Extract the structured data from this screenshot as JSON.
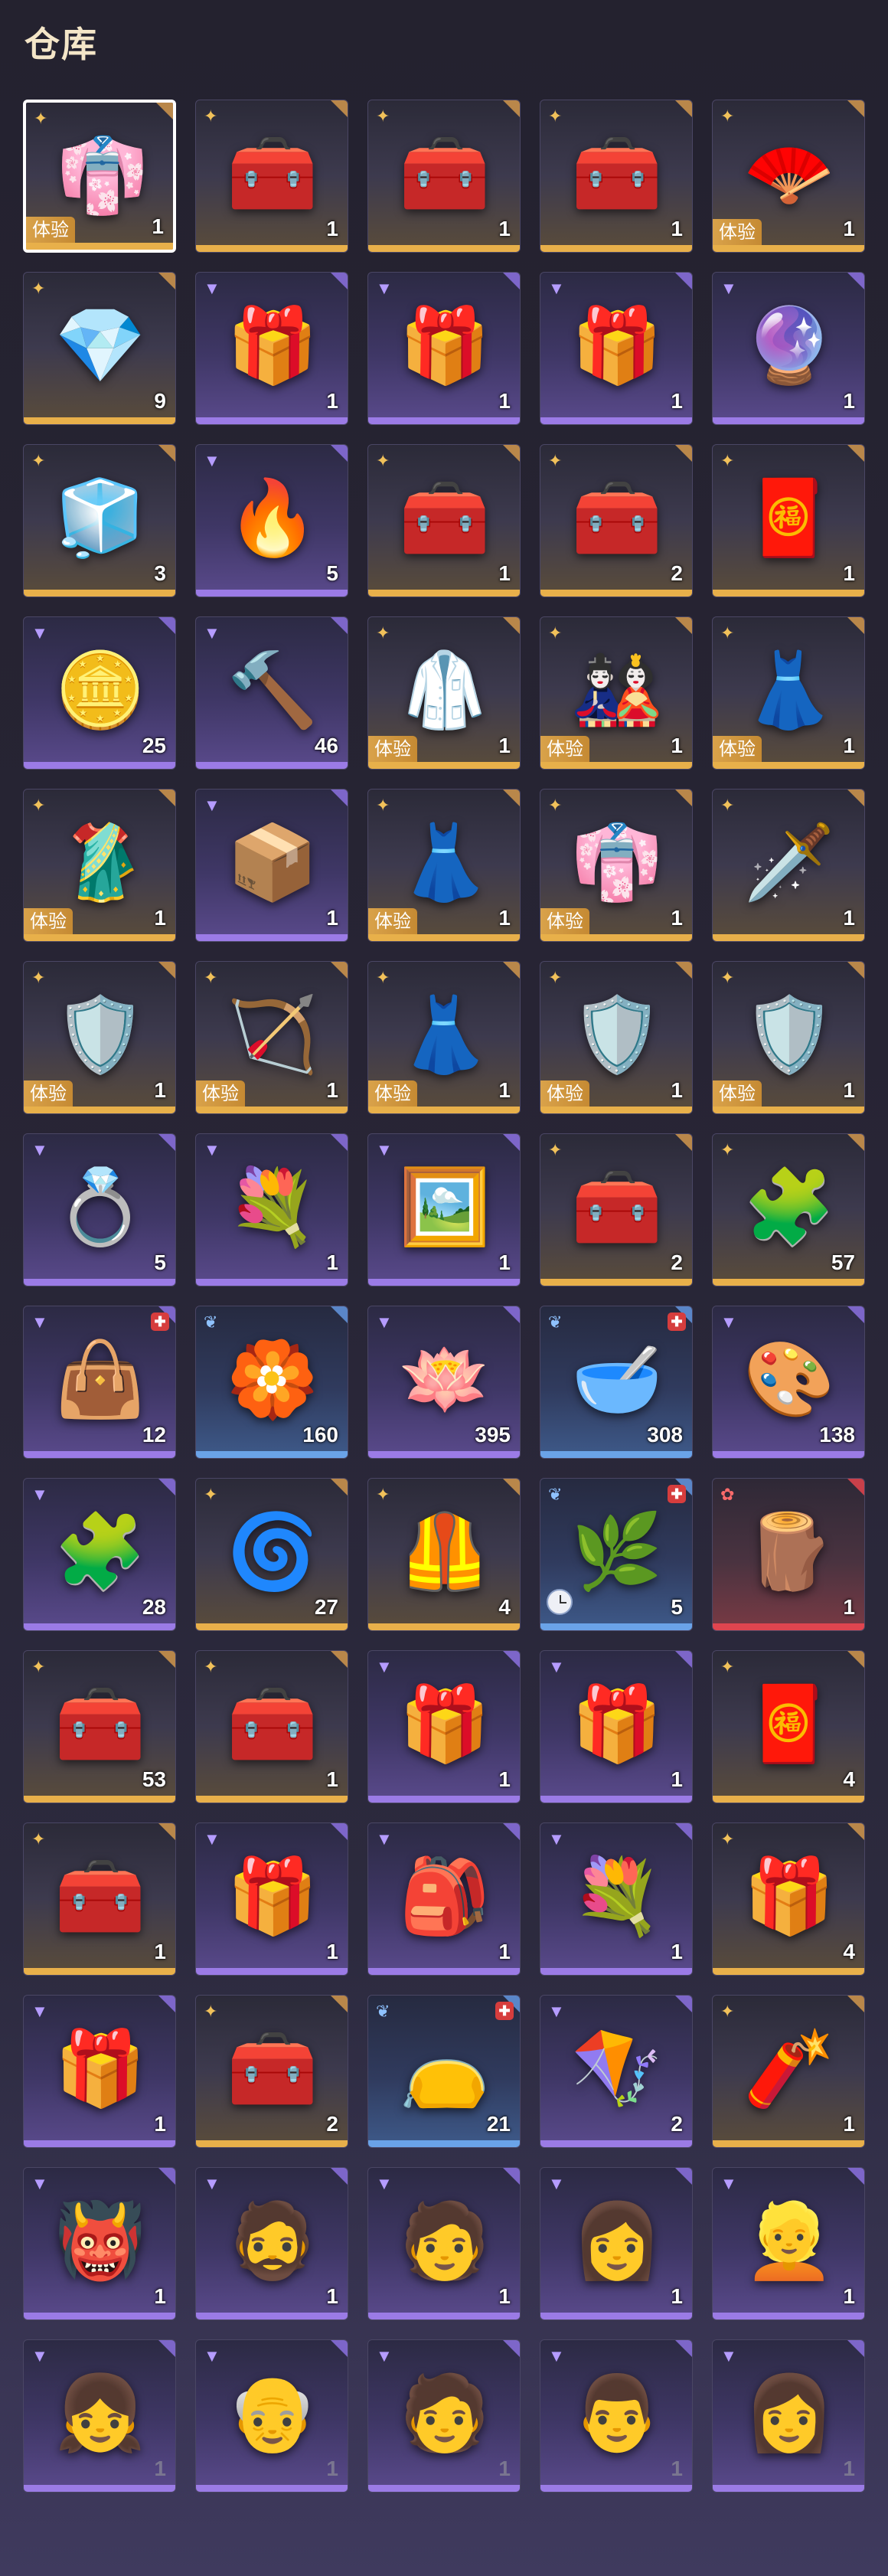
{
  "header": {
    "title": "仓库"
  },
  "trial_label": "体验",
  "rarity_colors": {
    "gold": "#e8b04a",
    "purple": "#9b7be6",
    "blue": "#6aa3e8",
    "red": "#e0454f"
  },
  "items": [
    {
      "icon": "blue-outfit",
      "glyph": "👘",
      "rarity": "gold",
      "qty": "1",
      "trial": true,
      "selected": true
    },
    {
      "icon": "treasure-chest",
      "glyph": "🧰",
      "rarity": "gold",
      "qty": "1",
      "trial": false
    },
    {
      "icon": "treasure-chest",
      "glyph": "🧰",
      "rarity": "gold",
      "qty": "1",
      "trial": false
    },
    {
      "icon": "treasure-chest",
      "glyph": "🧰",
      "rarity": "gold",
      "qty": "1",
      "trial": false
    },
    {
      "icon": "feather-fan",
      "glyph": "🪭",
      "rarity": "gold",
      "qty": "1",
      "trial": true
    },
    {
      "icon": "crystal",
      "glyph": "💎",
      "rarity": "gold",
      "qty": "9",
      "trial": false
    },
    {
      "icon": "loot-box",
      "glyph": "🎁",
      "rarity": "purple",
      "qty": "1",
      "trial": false
    },
    {
      "icon": "wrapped-gift",
      "glyph": "🎁",
      "rarity": "purple",
      "qty": "1",
      "trial": false
    },
    {
      "icon": "wrapped-gift",
      "glyph": "🎁",
      "rarity": "purple",
      "qty": "1",
      "trial": false
    },
    {
      "icon": "purple-gem",
      "glyph": "🔮",
      "rarity": "purple",
      "qty": "1",
      "trial": false
    },
    {
      "icon": "jade-cube",
      "glyph": "🧊",
      "rarity": "gold",
      "qty": "3",
      "trial": false
    },
    {
      "icon": "flame-stone",
      "glyph": "🔥",
      "rarity": "purple",
      "qty": "5",
      "trial": false
    },
    {
      "icon": "treasure-chest",
      "glyph": "🧰",
      "rarity": "gold",
      "qty": "1",
      "trial": false
    },
    {
      "icon": "ornate-chest",
      "glyph": "🧰",
      "rarity": "gold",
      "qty": "2",
      "trial": false
    },
    {
      "icon": "red-cube",
      "glyph": "🧧",
      "rarity": "gold",
      "qty": "1",
      "trial": false
    },
    {
      "icon": "gold-coins",
      "glyph": "🪙",
      "rarity": "purple",
      "qty": "25",
      "trial": false
    },
    {
      "icon": "hammer",
      "glyph": "🔨",
      "rarity": "purple",
      "qty": "46",
      "trial": false
    },
    {
      "icon": "white-robe",
      "glyph": "🥼",
      "rarity": "gold",
      "qty": "1",
      "trial": true
    },
    {
      "icon": "red-armor",
      "glyph": "🎎",
      "rarity": "gold",
      "qty": "1",
      "trial": true
    },
    {
      "icon": "white-gown",
      "glyph": "👗",
      "rarity": "gold",
      "qty": "1",
      "trial": true
    },
    {
      "icon": "blue-robe",
      "glyph": "🥻",
      "rarity": "gold",
      "qty": "1",
      "trial": true
    },
    {
      "icon": "white-chest",
      "glyph": "📦",
      "rarity": "purple",
      "qty": "1",
      "trial": false
    },
    {
      "icon": "blue-dress",
      "glyph": "👗",
      "rarity": "gold",
      "qty": "1",
      "trial": true
    },
    {
      "icon": "lavender-dress",
      "glyph": "👘",
      "rarity": "gold",
      "qty": "1",
      "trial": true
    },
    {
      "icon": "ice-blade",
      "glyph": "🗡️",
      "rarity": "gold",
      "qty": "1",
      "trial": false
    },
    {
      "icon": "dark-armor",
      "glyph": "🛡️",
      "rarity": "gold",
      "qty": "1",
      "trial": true
    },
    {
      "icon": "crossbow",
      "glyph": "🏹",
      "rarity": "gold",
      "qty": "1",
      "trial": true
    },
    {
      "icon": "white-red-dress",
      "glyph": "👗",
      "rarity": "gold",
      "qty": "1",
      "trial": true
    },
    {
      "icon": "gold-armor",
      "glyph": "🛡️",
      "rarity": "gold",
      "qty": "1",
      "trial": true
    },
    {
      "icon": "gold-armor",
      "glyph": "🛡️",
      "rarity": "gold",
      "qty": "1",
      "trial": true
    },
    {
      "icon": "jewel-box",
      "glyph": "💍",
      "rarity": "purple",
      "qty": "5",
      "trial": false
    },
    {
      "icon": "flower-gift",
      "glyph": "💐",
      "rarity": "purple",
      "qty": "1",
      "trial": false
    },
    {
      "icon": "photo-card",
      "glyph": "🖼️",
      "rarity": "purple",
      "qty": "1",
      "trial": false
    },
    {
      "icon": "jade-chest",
      "glyph": "🧰",
      "rarity": "gold",
      "qty": "2",
      "trial": false
    },
    {
      "icon": "puzzle-chest",
      "glyph": "🧩",
      "rarity": "gold",
      "qty": "57",
      "trial": false
    },
    {
      "icon": "leather-bag",
      "glyph": "👜",
      "rarity": "purple",
      "qty": "12",
      "trial": false,
      "badge": "✚"
    },
    {
      "icon": "ember-sigil",
      "glyph": "🏵️",
      "rarity": "blue",
      "qty": "160",
      "trial": false
    },
    {
      "icon": "lotus-dish",
      "glyph": "🪷",
      "rarity": "purple",
      "qty": "395",
      "trial": false
    },
    {
      "icon": "pigment-bowl",
      "glyph": "🥣",
      "rarity": "blue",
      "qty": "308",
      "trial": false,
      "badge": "✚"
    },
    {
      "icon": "tricolor-bowl",
      "glyph": "🎨",
      "rarity": "purple",
      "qty": "138",
      "trial": false
    },
    {
      "icon": "jade-puzzle",
      "glyph": "🧩",
      "rarity": "purple",
      "qty": "28",
      "trial": false
    },
    {
      "icon": "spirit-crystal",
      "glyph": "🌀",
      "rarity": "gold",
      "qty": "27",
      "trial": false
    },
    {
      "icon": "chain-vest",
      "glyph": "🦺",
      "rarity": "gold",
      "qty": "4",
      "trial": false
    },
    {
      "icon": "lotus-pod",
      "glyph": "🌿",
      "rarity": "blue",
      "qty": "5",
      "trial": false,
      "badge": "✚",
      "timed": true
    },
    {
      "icon": "wooden-chest",
      "glyph": "🪵",
      "rarity": "red",
      "qty": "1",
      "trial": false
    },
    {
      "icon": "ornate-chest",
      "glyph": "🧰",
      "rarity": "gold",
      "qty": "53",
      "trial": false
    },
    {
      "icon": "ornate-chest",
      "glyph": "🧰",
      "rarity": "gold",
      "qty": "1",
      "trial": false
    },
    {
      "icon": "wrapped-gift",
      "glyph": "🎁",
      "rarity": "purple",
      "qty": "1",
      "trial": false
    },
    {
      "icon": "wrapped-gift",
      "glyph": "🎁",
      "rarity": "purple",
      "qty": "1",
      "trial": false
    },
    {
      "icon": "red-pouch",
      "glyph": "🧧",
      "rarity": "gold",
      "qty": "4",
      "trial": false
    },
    {
      "icon": "treasure-chest",
      "glyph": "🧰",
      "rarity": "gold",
      "qty": "1",
      "trial": false
    },
    {
      "icon": "wrapped-gift",
      "glyph": "🎁",
      "rarity": "purple",
      "qty": "1",
      "trial": false
    },
    {
      "icon": "mystery-bag",
      "glyph": "🎒",
      "rarity": "purple",
      "qty": "1",
      "trial": false
    },
    {
      "icon": "flower-gift",
      "glyph": "💐",
      "rarity": "purple",
      "qty": "1",
      "trial": false
    },
    {
      "icon": "wrapped-gift",
      "glyph": "🎁",
      "rarity": "gold",
      "qty": "4",
      "trial": false
    },
    {
      "icon": "blue-gift",
      "glyph": "🎁",
      "rarity": "purple",
      "qty": "1",
      "trial": false
    },
    {
      "icon": "ornate-chest",
      "glyph": "🧰",
      "rarity": "gold",
      "qty": "2",
      "trial": false
    },
    {
      "icon": "silk-pouch",
      "glyph": "👝",
      "rarity": "blue",
      "qty": "21",
      "trial": false,
      "badge": "✚"
    },
    {
      "icon": "kite",
      "glyph": "🪁",
      "rarity": "purple",
      "qty": "2",
      "trial": false
    },
    {
      "icon": "firecracker",
      "glyph": "🧨",
      "rarity": "gold",
      "qty": "1",
      "trial": false
    },
    {
      "icon": "portrait-scroll",
      "glyph": "👹",
      "rarity": "purple",
      "qty": "1",
      "trial": false
    },
    {
      "icon": "portrait-scroll",
      "glyph": "🧔",
      "rarity": "purple",
      "qty": "1",
      "trial": false
    },
    {
      "icon": "portrait-scroll",
      "glyph": "🧑",
      "rarity": "purple",
      "qty": "1",
      "trial": false
    },
    {
      "icon": "portrait-scroll",
      "glyph": "👩",
      "rarity": "purple",
      "qty": "1",
      "trial": false
    },
    {
      "icon": "portrait-scroll",
      "glyph": "👱",
      "rarity": "purple",
      "qty": "1",
      "trial": false
    },
    {
      "icon": "portrait-scroll",
      "glyph": "👧",
      "rarity": "purple",
      "qty": "1",
      "trial": false,
      "dim": true
    },
    {
      "icon": "portrait-scroll",
      "glyph": "👴",
      "rarity": "purple",
      "qty": "1",
      "trial": false,
      "dim": true
    },
    {
      "icon": "portrait-scroll",
      "glyph": "🧑",
      "rarity": "purple",
      "qty": "1",
      "trial": false,
      "dim": true
    },
    {
      "icon": "portrait-scroll",
      "glyph": "👨",
      "rarity": "purple",
      "qty": "1",
      "trial": false,
      "dim": true
    },
    {
      "icon": "portrait-scroll",
      "glyph": "👩",
      "rarity": "purple",
      "qty": "1",
      "trial": false,
      "dim": true
    }
  ]
}
